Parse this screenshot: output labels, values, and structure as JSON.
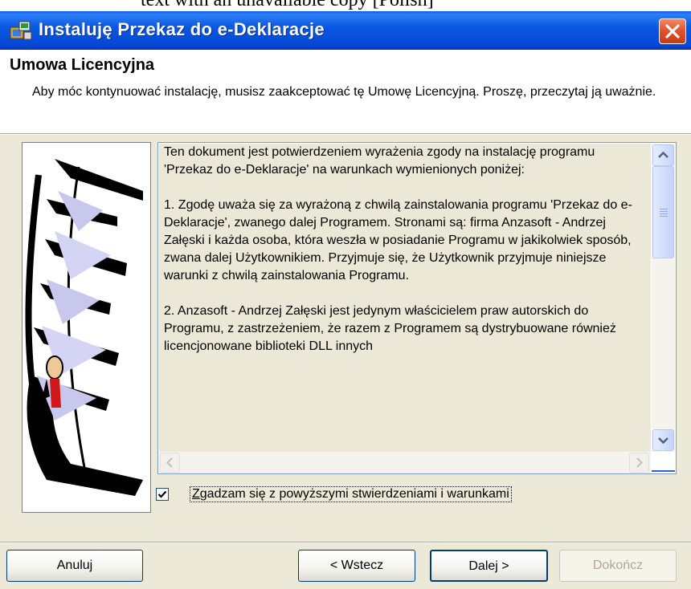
{
  "window": {
    "title": "Instaluję Przekaz do e-Deklaracje",
    "top_cropped_text": "text with an unavailable copy [Polish]"
  },
  "header": {
    "title": "Umowa Licencyjna",
    "description": "Aby móc kontynuować instalację, musisz zaakceptować tę Umowę Licencyjną. Proszę, przeczytaj ją uważnie."
  },
  "license": {
    "text": "Ten dokument jest potwierdzeniem wyrażenia zgody na instalację programu 'Przekaz do e-Deklaracje' na warunkach wymienionych poniżej:\n\n1. Zgodę uważa się za wyrażoną z chwilą zainstalowania programu 'Przekaz do e-Deklaracje', zwanego dalej Programem. Stronami są: firma Anzasoft - Andrzej Załęski i każda osoba, która weszła w posiadanie Programu w jakikolwiek sposób, zwana dalej Użytkownikiem. Przyjmuje się, że Użytkownik przyjmuje niniejsze warunki z chwilą zainstalowania Programu.\n\n2. Anzasoft - Andrzej Załęski jest jedynym właścicielem praw autorskich do Programu, z zastrzeżeniem, że razem z Programem są dystrybuowane również licencjonowane biblioteki DLL innych"
  },
  "agreement": {
    "checked": true,
    "label_first_letter": "Z",
    "label_rest": "gadzam się z powyższymi stwierdzeniami i warunkami"
  },
  "buttons": {
    "cancel": "Anuluj",
    "back": "< Wstecz",
    "next": "Dalej >",
    "finish": "Dokończ"
  },
  "colors": {
    "titlebar": "#0548d4",
    "dialog_bg": "#ece9d8",
    "scrollbar": "#c5d5fb"
  }
}
